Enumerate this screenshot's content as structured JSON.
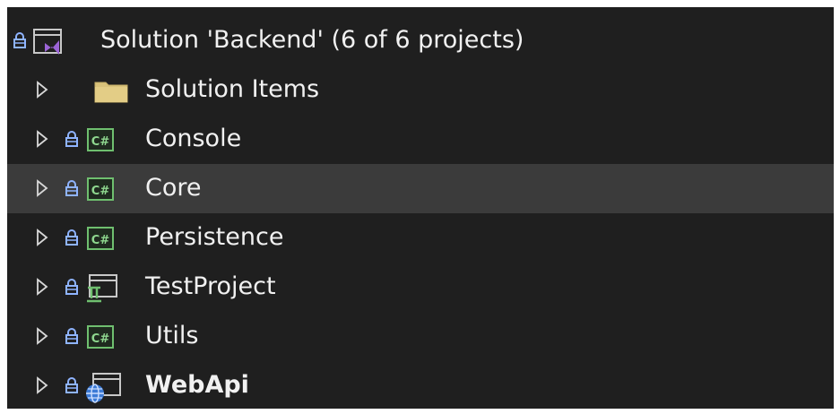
{
  "solution_explorer": {
    "root": {
      "label": "Solution 'Backend' (6 of 6 projects)",
      "icon": "visual-studio-solution-icon",
      "locked": true
    },
    "items": [
      {
        "label": "Solution Items",
        "icon": "folder-icon",
        "locked": false,
        "bold": false,
        "selected": false
      },
      {
        "label": "Console",
        "icon": "csharp-project-icon",
        "locked": true,
        "bold": false,
        "selected": false
      },
      {
        "label": "Core",
        "icon": "csharp-project-icon",
        "locked": true,
        "bold": false,
        "selected": true
      },
      {
        "label": "Persistence",
        "icon": "csharp-project-icon",
        "locked": true,
        "bold": false,
        "selected": false
      },
      {
        "label": "TestProject",
        "icon": "test-project-icon",
        "locked": true,
        "bold": false,
        "selected": false
      },
      {
        "label": "Utils",
        "icon": "csharp-project-icon",
        "locked": true,
        "bold": false,
        "selected": false
      },
      {
        "label": "WebApi",
        "icon": "web-project-icon",
        "locked": true,
        "bold": true,
        "selected": false
      }
    ],
    "colors": {
      "background": "#1f1f1f",
      "selected_row": "#3b3b3b",
      "text": "#f1f1f1",
      "lock": "#8fb4ff",
      "csharp_badge": "#6fbf6f",
      "folder": "#d9c27a",
      "vs_purple": "#9b64d6"
    }
  }
}
